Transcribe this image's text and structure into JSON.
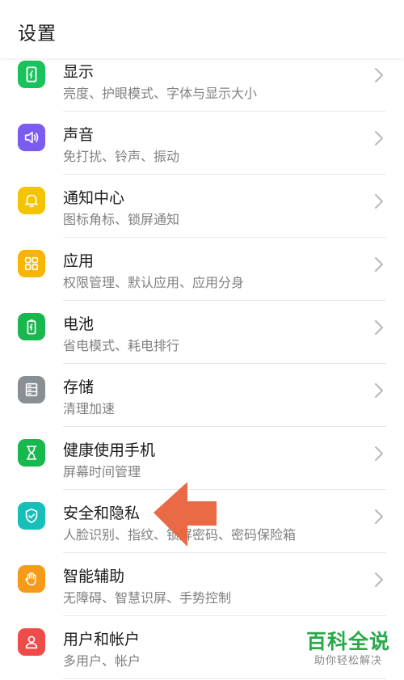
{
  "header": {
    "title": "设置"
  },
  "items": [
    {
      "title": "显示",
      "subtitle": "亮度、护眼模式、字体与显示大小",
      "color": "#19c25a",
      "icon": "display-icon"
    },
    {
      "title": "声音",
      "subtitle": "免打扰、铃声、振动",
      "color": "#7b5cf0",
      "icon": "speaker-icon"
    },
    {
      "title": "通知中心",
      "subtitle": "图标角标、锁屏通知",
      "color": "#f5c400",
      "icon": "bell-icon"
    },
    {
      "title": "应用",
      "subtitle": "权限管理、默认应用、应用分身",
      "color": "#f7b500",
      "icon": "apps-grid-icon"
    },
    {
      "title": "电池",
      "subtitle": "省电模式、耗电排行",
      "color": "#19b84e",
      "icon": "battery-icon"
    },
    {
      "title": "存储",
      "subtitle": "清理加速",
      "color": "#8a8f96",
      "icon": "storage-icon"
    },
    {
      "title": "健康使用手机",
      "subtitle": "屏幕时间管理",
      "color": "#19b84e",
      "icon": "hourglass-icon"
    },
    {
      "title": "安全和隐私",
      "subtitle": "人脸识别、指纹、锁屏密码、密码保险箱",
      "color": "#16c0b8",
      "icon": "shield-icon"
    },
    {
      "title": "智能辅助",
      "subtitle": "无障碍、智慧识屏、手势控制",
      "color": "#f59a1b",
      "icon": "hand-icon"
    },
    {
      "title": "用户和帐户",
      "subtitle": "多用户、帐户",
      "color": "#f04b4b",
      "icon": "user-icon"
    }
  ],
  "annotation": {
    "color": "#e8623a"
  },
  "watermark": {
    "title": "百科全说",
    "subtitle": "助你轻松解决"
  }
}
